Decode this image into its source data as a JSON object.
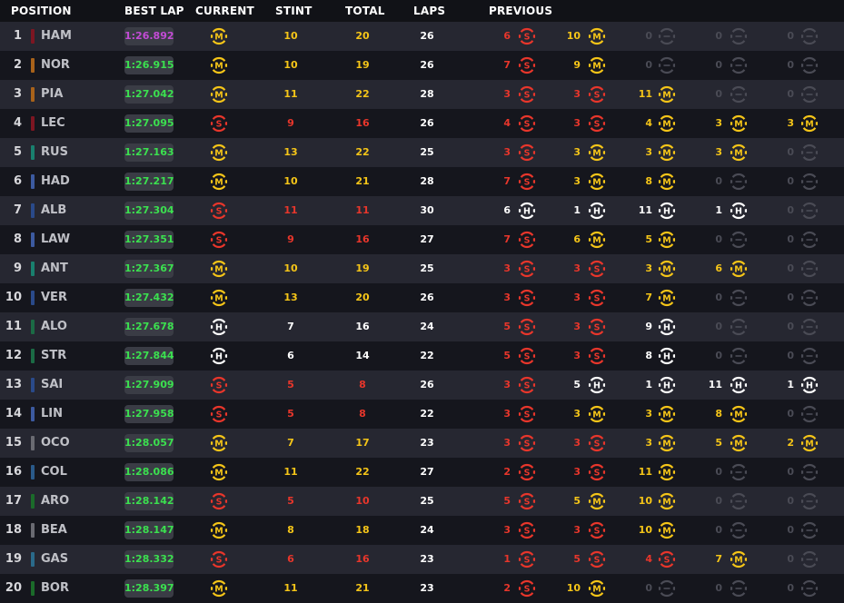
{
  "headers": {
    "position": "POSITION",
    "best_lap": "BEST LAP",
    "current": "CURRENT",
    "stint": "STINT",
    "total": "TOTAL",
    "laps": "LAPS",
    "previous": "PREVIOUS"
  },
  "compound_letters": {
    "S": "S",
    "M": "M",
    "H": "H"
  },
  "colors": {
    "soft": "#e8362b",
    "medium": "#f5c518",
    "hard": "#ffffff",
    "inactive": "#4a4b55",
    "fastest_lap": "#c34bd6",
    "best_lap": "#3be04f"
  },
  "rows": [
    {
      "pos": "1",
      "driver": "HAM",
      "team_color": "#7d1622",
      "best_lap": "1:26.892",
      "fastest": true,
      "current": "M",
      "stint": "10",
      "total": "20",
      "laps": "26",
      "prev": [
        [
          "6",
          "S"
        ],
        [
          "10",
          "M"
        ],
        [
          "0",
          ""
        ],
        [
          "0",
          ""
        ],
        [
          "0",
          ""
        ]
      ]
    },
    {
      "pos": "2",
      "driver": "NOR",
      "team_color": "#a8621a",
      "best_lap": "1:26.915",
      "current": "M",
      "stint": "10",
      "total": "19",
      "laps": "26",
      "prev": [
        [
          "7",
          "S"
        ],
        [
          "9",
          "M"
        ],
        [
          "0",
          ""
        ],
        [
          "0",
          ""
        ],
        [
          "0",
          ""
        ]
      ]
    },
    {
      "pos": "3",
      "driver": "PIA",
      "team_color": "#a8621a",
      "best_lap": "1:27.042",
      "current": "M",
      "stint": "11",
      "total": "22",
      "laps": "28",
      "prev": [
        [
          "3",
          "S"
        ],
        [
          "3",
          "S"
        ],
        [
          "11",
          "M"
        ],
        [
          "0",
          ""
        ],
        [
          "0",
          ""
        ]
      ]
    },
    {
      "pos": "4",
      "driver": "LEC",
      "team_color": "#7d1622",
      "best_lap": "1:27.095",
      "current": "S",
      "stint": "9",
      "total": "16",
      "laps": "26",
      "prev": [
        [
          "4",
          "S"
        ],
        [
          "3",
          "S"
        ],
        [
          "4",
          "M"
        ],
        [
          "3",
          "M"
        ],
        [
          "3",
          "M"
        ]
      ]
    },
    {
      "pos": "5",
      "driver": "RUS",
      "team_color": "#19806e",
      "best_lap": "1:27.163",
      "current": "M",
      "stint": "13",
      "total": "22",
      "laps": "25",
      "prev": [
        [
          "3",
          "S"
        ],
        [
          "3",
          "M"
        ],
        [
          "3",
          "M"
        ],
        [
          "3",
          "M"
        ],
        [
          "0",
          ""
        ]
      ]
    },
    {
      "pos": "6",
      "driver": "HAD",
      "team_color": "#3c5aa0",
      "best_lap": "1:27.217",
      "current": "M",
      "stint": "10",
      "total": "21",
      "laps": "28",
      "prev": [
        [
          "7",
          "S"
        ],
        [
          "3",
          "M"
        ],
        [
          "8",
          "M"
        ],
        [
          "0",
          ""
        ],
        [
          "0",
          ""
        ]
      ]
    },
    {
      "pos": "7",
      "driver": "ALB",
      "team_color": "#2a4a8a",
      "best_lap": "1:27.304",
      "current": "S",
      "stint": "11",
      "total": "11",
      "laps": "30",
      "prev": [
        [
          "6",
          "H"
        ],
        [
          "1",
          "H"
        ],
        [
          "11",
          "H"
        ],
        [
          "1",
          "H"
        ],
        [
          "0",
          ""
        ]
      ]
    },
    {
      "pos": "8",
      "driver": "LAW",
      "team_color": "#3c5aa0",
      "best_lap": "1:27.351",
      "current": "S",
      "stint": "9",
      "total": "16",
      "laps": "27",
      "prev": [
        [
          "7",
          "S"
        ],
        [
          "6",
          "M"
        ],
        [
          "5",
          "M"
        ],
        [
          "0",
          ""
        ],
        [
          "0",
          ""
        ]
      ]
    },
    {
      "pos": "9",
      "driver": "ANT",
      "team_color": "#19806e",
      "best_lap": "1:27.367",
      "current": "M",
      "stint": "10",
      "total": "19",
      "laps": "25",
      "prev": [
        [
          "3",
          "S"
        ],
        [
          "3",
          "S"
        ],
        [
          "3",
          "M"
        ],
        [
          "6",
          "M"
        ],
        [
          "0",
          ""
        ]
      ]
    },
    {
      "pos": "10",
      "driver": "VER",
      "team_color": "#2a4a8a",
      "best_lap": "1:27.432",
      "current": "M",
      "stint": "13",
      "total": "20",
      "laps": "26",
      "prev": [
        [
          "3",
          "S"
        ],
        [
          "3",
          "S"
        ],
        [
          "7",
          "M"
        ],
        [
          "0",
          ""
        ],
        [
          "0",
          ""
        ]
      ]
    },
    {
      "pos": "11",
      "driver": "ALO",
      "team_color": "#1b6b45",
      "best_lap": "1:27.678",
      "current": "H",
      "stint": "7",
      "total": "16",
      "laps": "24",
      "prev": [
        [
          "5",
          "S"
        ],
        [
          "3",
          "S"
        ],
        [
          "9",
          "H"
        ],
        [
          "0",
          ""
        ],
        [
          "0",
          ""
        ]
      ]
    },
    {
      "pos": "12",
      "driver": "STR",
      "team_color": "#1b6b45",
      "best_lap": "1:27.844",
      "current": "H",
      "stint": "6",
      "total": "14",
      "laps": "22",
      "prev": [
        [
          "5",
          "S"
        ],
        [
          "3",
          "S"
        ],
        [
          "8",
          "H"
        ],
        [
          "0",
          ""
        ],
        [
          "0",
          ""
        ]
      ]
    },
    {
      "pos": "13",
      "driver": "SAI",
      "team_color": "#2a4a8a",
      "best_lap": "1:27.909",
      "current": "S",
      "stint": "5",
      "total": "8",
      "laps": "26",
      "prev": [
        [
          "3",
          "S"
        ],
        [
          "5",
          "H"
        ],
        [
          "1",
          "H"
        ],
        [
          "11",
          "H"
        ],
        [
          "1",
          "H"
        ]
      ]
    },
    {
      "pos": "14",
      "driver": "LIN",
      "team_color": "#3c5aa0",
      "best_lap": "1:27.958",
      "current": "S",
      "stint": "5",
      "total": "8",
      "laps": "22",
      "prev": [
        [
          "3",
          "S"
        ],
        [
          "3",
          "M"
        ],
        [
          "3",
          "M"
        ],
        [
          "8",
          "M"
        ],
        [
          "0",
          ""
        ]
      ]
    },
    {
      "pos": "15",
      "driver": "OCO",
      "team_color": "#6a6b72",
      "best_lap": "1:28.057",
      "current": "M",
      "stint": "7",
      "total": "17",
      "laps": "23",
      "prev": [
        [
          "3",
          "S"
        ],
        [
          "3",
          "S"
        ],
        [
          "3",
          "M"
        ],
        [
          "5",
          "M"
        ],
        [
          "2",
          "M"
        ]
      ]
    },
    {
      "pos": "16",
      "driver": "COL",
      "team_color": "#2a5a8a",
      "best_lap": "1:28.086",
      "current": "M",
      "stint": "11",
      "total": "22",
      "laps": "27",
      "prev": [
        [
          "2",
          "S"
        ],
        [
          "3",
          "S"
        ],
        [
          "11",
          "M"
        ],
        [
          "0",
          ""
        ],
        [
          "0",
          ""
        ]
      ]
    },
    {
      "pos": "17",
      "driver": "ARO",
      "team_color": "#1b6b2a",
      "best_lap": "1:28.142",
      "current": "S",
      "stint": "5",
      "total": "10",
      "laps": "25",
      "prev": [
        [
          "5",
          "S"
        ],
        [
          "5",
          "M"
        ],
        [
          "10",
          "M"
        ],
        [
          "0",
          ""
        ],
        [
          "0",
          ""
        ]
      ]
    },
    {
      "pos": "18",
      "driver": "BEA",
      "team_color": "#6a6b72",
      "best_lap": "1:28.147",
      "current": "M",
      "stint": "8",
      "total": "18",
      "laps": "24",
      "prev": [
        [
          "3",
          "S"
        ],
        [
          "3",
          "S"
        ],
        [
          "10",
          "M"
        ],
        [
          "0",
          ""
        ],
        [
          "0",
          ""
        ]
      ]
    },
    {
      "pos": "19",
      "driver": "GAS",
      "team_color": "#2a6a8a",
      "best_lap": "1:28.332",
      "current": "S",
      "stint": "6",
      "total": "16",
      "laps": "23",
      "prev": [
        [
          "1",
          "S"
        ],
        [
          "5",
          "S"
        ],
        [
          "4",
          "S"
        ],
        [
          "7",
          "M"
        ],
        [
          "0",
          ""
        ]
      ]
    },
    {
      "pos": "20",
      "driver": "BOR",
      "team_color": "#1b6b2a",
      "best_lap": "1:28.397",
      "current": "M",
      "stint": "11",
      "total": "21",
      "laps": "23",
      "prev": [
        [
          "2",
          "S"
        ],
        [
          "10",
          "M"
        ],
        [
          "0",
          ""
        ],
        [
          "0",
          ""
        ],
        [
          "0",
          ""
        ]
      ]
    }
  ]
}
